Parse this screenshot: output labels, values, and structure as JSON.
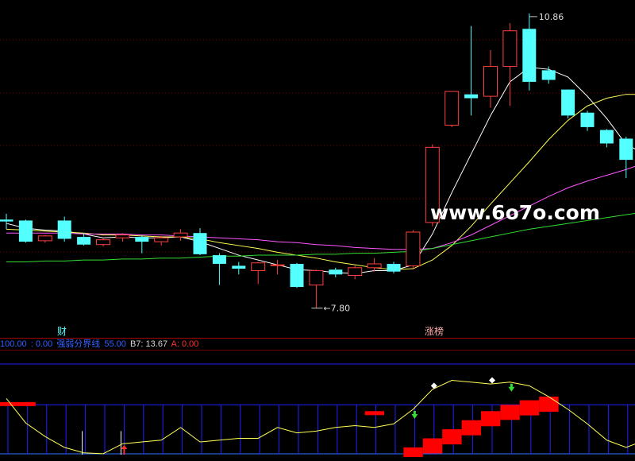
{
  "watermark": "www.6o7o.com",
  "badges": {
    "finance": "财",
    "limit_up": "涨榜"
  },
  "indicator": {
    "items": [
      {
        "text": "100.00",
        "color": "#3060ff"
      },
      {
        "text": ": 0.00",
        "color": "#3060ff"
      },
      {
        "text": "强弱分界线",
        "color": "#3060ff"
      },
      {
        "text": "55.00",
        "color": "#3060ff"
      },
      {
        "text": "B7: 13.67",
        "color": "#d8d8d8"
      },
      {
        "text": "A: 0.00",
        "color": "#ff3030"
      }
    ]
  },
  "colors": {
    "up": "#ff4040",
    "down": "#54ffff",
    "ma5": "#ffffff",
    "ma10": "#ffff55",
    "ma20": "#ff55ff",
    "ma60": "#33dd33",
    "grid": "#800000",
    "blue_line": "#2020ff"
  },
  "chart_data": [
    {
      "type": "candlestick",
      "annotations": [
        {
          "text": "10.86",
          "kind": "high",
          "price": 10.86
        },
        {
          "text": "7.80",
          "kind": "low",
          "price": 7.8
        }
      ],
      "ylim": [
        7.55,
        10.95
      ],
      "candles": [
        {
          "o": 8.72,
          "h": 8.78,
          "l": 8.62,
          "c": 8.7
        },
        {
          "o": 8.71,
          "h": 8.72,
          "l": 8.48,
          "c": 8.49
        },
        {
          "o": 8.5,
          "h": 8.56,
          "l": 8.48,
          "c": 8.55
        },
        {
          "o": 8.71,
          "h": 8.75,
          "l": 8.49,
          "c": 8.52
        },
        {
          "o": 8.54,
          "h": 8.58,
          "l": 8.45,
          "c": 8.46
        },
        {
          "o": 8.46,
          "h": 8.53,
          "l": 8.44,
          "c": 8.51
        },
        {
          "o": 8.53,
          "h": 8.58,
          "l": 8.49,
          "c": 8.56
        },
        {
          "o": 8.54,
          "h": 8.56,
          "l": 8.37,
          "c": 8.49
        },
        {
          "o": 8.49,
          "h": 8.55,
          "l": 8.45,
          "c": 8.53
        },
        {
          "o": 8.54,
          "h": 8.62,
          "l": 8.5,
          "c": 8.58
        },
        {
          "o": 8.58,
          "h": 8.63,
          "l": 8.35,
          "c": 8.36
        },
        {
          "o": 8.35,
          "h": 8.37,
          "l": 8.04,
          "c": 8.26
        },
        {
          "o": 8.24,
          "h": 8.28,
          "l": 8.15,
          "c": 8.21
        },
        {
          "o": 8.19,
          "h": 8.28,
          "l": 8.05,
          "c": 8.27
        },
        {
          "o": 8.25,
          "h": 8.3,
          "l": 8.15,
          "c": 8.25
        },
        {
          "o": 8.26,
          "h": 8.27,
          "l": 8.01,
          "c": 8.02
        },
        {
          "o": 8.04,
          "h": 8.2,
          "l": 7.8,
          "c": 8.19
        },
        {
          "o": 8.2,
          "h": 8.22,
          "l": 8.12,
          "c": 8.15
        },
        {
          "o": 8.14,
          "h": 8.24,
          "l": 8.1,
          "c": 8.22
        },
        {
          "o": 8.22,
          "h": 8.32,
          "l": 8.18,
          "c": 8.26
        },
        {
          "o": 8.26,
          "h": 8.28,
          "l": 8.16,
          "c": 8.18
        },
        {
          "o": 8.24,
          "h": 8.61,
          "l": 8.2,
          "c": 8.59
        },
        {
          "o": 8.69,
          "h": 9.5,
          "l": 8.65,
          "c": 9.47
        },
        {
          "o": 9.7,
          "h": 10.05,
          "l": 9.68,
          "c": 10.05
        },
        {
          "o": 10.02,
          "h": 10.73,
          "l": 9.8,
          "c": 9.98
        },
        {
          "o": 10.0,
          "h": 10.48,
          "l": 9.88,
          "c": 10.31
        },
        {
          "o": 10.31,
          "h": 10.76,
          "l": 9.9,
          "c": 10.68
        },
        {
          "o": 10.7,
          "h": 10.86,
          "l": 10.06,
          "c": 10.15
        },
        {
          "o": 10.27,
          "h": 10.31,
          "l": 10.13,
          "c": 10.17
        },
        {
          "o": 10.07,
          "h": 10.07,
          "l": 9.77,
          "c": 9.8
        },
        {
          "o": 9.83,
          "h": 9.85,
          "l": 9.64,
          "c": 9.68
        },
        {
          "o": 9.65,
          "h": 9.66,
          "l": 9.47,
          "c": 9.51
        },
        {
          "o": 9.56,
          "h": 9.58,
          "l": 9.15,
          "c": 9.34
        },
        {
          "o": 9.65,
          "h": 10.28,
          "l": 9.51,
          "c": 10.09
        }
      ],
      "series": [
        {
          "line": "ma5",
          "values": [
            8.68,
            8.63,
            8.61,
            8.6,
            8.57,
            8.53,
            8.54,
            8.53,
            8.53,
            8.54,
            8.49,
            8.42,
            8.35,
            8.3,
            8.25,
            8.2,
            8.19,
            8.17,
            8.16,
            8.19,
            8.19,
            8.25,
            8.57,
            9.0,
            9.4,
            9.8,
            10.15,
            10.3,
            10.28,
            10.2,
            10.0,
            9.77,
            9.5,
            9.4
          ]
        },
        {
          "line": "ma10",
          "values": [
            8.62,
            8.61,
            8.6,
            8.59,
            8.58,
            8.56,
            8.56,
            8.55,
            8.54,
            8.54,
            8.52,
            8.48,
            8.45,
            8.42,
            8.38,
            8.35,
            8.32,
            8.28,
            8.25,
            8.22,
            8.2,
            8.21,
            8.3,
            8.45,
            8.65,
            8.88,
            9.1,
            9.32,
            9.55,
            9.75,
            9.9,
            9.98,
            10.02,
            10.02
          ]
        },
        {
          "line": "ma20",
          "values": [
            8.58,
            8.58,
            8.58,
            8.58,
            8.57,
            8.57,
            8.57,
            8.56,
            8.56,
            8.55,
            8.54,
            8.53,
            8.52,
            8.51,
            8.49,
            8.48,
            8.46,
            8.45,
            8.43,
            8.42,
            8.41,
            8.41,
            8.42,
            8.48,
            8.56,
            8.66,
            8.76,
            8.86,
            8.96,
            9.05,
            9.12,
            9.18,
            9.24,
            9.31
          ]
        },
        {
          "line": "ma60",
          "values": [
            8.28,
            8.28,
            8.29,
            8.29,
            8.3,
            8.3,
            8.31,
            8.31,
            8.32,
            8.32,
            8.33,
            8.34,
            8.34,
            8.35,
            8.35,
            8.35,
            8.36,
            8.36,
            8.37,
            8.37,
            8.38,
            8.39,
            8.42,
            8.46,
            8.5,
            8.54,
            8.58,
            8.62,
            8.65,
            8.68,
            8.71,
            8.74,
            8.77,
            8.8
          ]
        }
      ]
    },
    {
      "type": "line",
      "ylim": [
        0,
        100
      ],
      "levels": [
        0,
        55,
        100
      ],
      "series": [
        {
          "line": "strength",
          "values": [
            62,
            35,
            20,
            8,
            2,
            1,
            12,
            14,
            16,
            30,
            14,
            16,
            18,
            18,
            30,
            24,
            26,
            30,
            32,
            30,
            34,
            50,
            72,
            82,
            80,
            78,
            80,
            76,
            64,
            50,
            34,
            16,
            8,
            16
          ]
        }
      ],
      "bars": [
        {
          "index": 0,
          "value": 58
        },
        {
          "index": 1,
          "value": 58
        },
        {
          "index": 19,
          "value": 48
        },
        {
          "index": 21,
          "value": 8
        },
        {
          "index": 22,
          "value": 18
        },
        {
          "index": 23,
          "value": 28
        },
        {
          "index": 24,
          "value": 38
        },
        {
          "index": 25,
          "value": 48
        },
        {
          "index": 26,
          "value": 55
        },
        {
          "index": 27,
          "value": 60
        },
        {
          "index": 28,
          "value": 64
        }
      ],
      "ticks": [
        4,
        6
      ],
      "markers": [
        {
          "index": 21,
          "kind": "arrow-down",
          "color": "#33dd33"
        },
        {
          "index": 22,
          "kind": "diamond",
          "color": "#ffffff"
        },
        {
          "index": 25,
          "kind": "diamond",
          "color": "#ffffff"
        },
        {
          "index": 26,
          "kind": "arrow-down",
          "color": "#33dd33"
        },
        {
          "index": 6,
          "kind": "arrow-up",
          "color": "#ff3030"
        }
      ]
    }
  ]
}
